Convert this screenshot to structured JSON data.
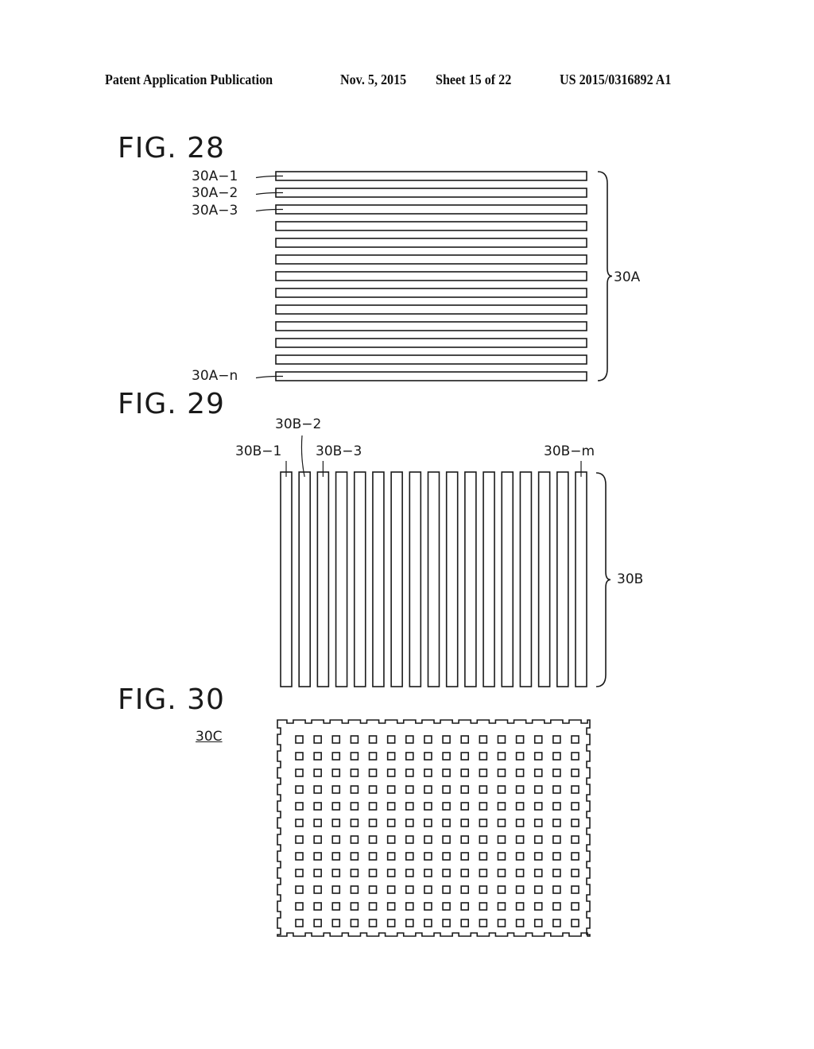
{
  "header": {
    "publication": "Patent Application Publication",
    "date": "Nov. 5, 2015",
    "sheet": "Sheet 15 of 22",
    "number": "US 2015/0316892 A1"
  },
  "fig28": {
    "title": "FIG. 28",
    "strip_count": 13,
    "labels": [
      "30A−1",
      "30A−2",
      "30A−3",
      "30A−n"
    ],
    "group_label": "30A"
  },
  "fig29": {
    "title": "FIG. 29",
    "strip_count": 17,
    "labels": [
      "30B−1",
      "30B−2",
      "30B−3",
      "30B−m"
    ],
    "group_label": "30B"
  },
  "fig30": {
    "title": "FIG. 30",
    "ref_label": "30C",
    "hole_rows": 12,
    "hole_cols": 16
  }
}
